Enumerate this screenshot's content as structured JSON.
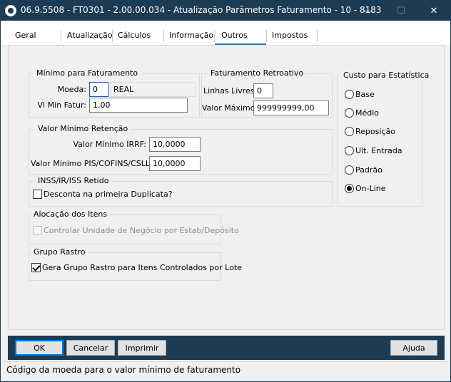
{
  "window": {
    "title": "06.9.5508 - FT0301 - 2.00.00.034 - Atualização Parâmetros Faturamento - 10 - 8183",
    "minimize_glyph": "—",
    "maximize_glyph": "☐",
    "close_glyph": "✕"
  },
  "tabs": [
    {
      "label": "Geral"
    },
    {
      "label": "Atualização"
    },
    {
      "label": "Cálculos"
    },
    {
      "label": "Informação"
    },
    {
      "label": "Outros",
      "active": true
    },
    {
      "label": "Impostos"
    }
  ],
  "minimo_faturamento": {
    "title": "Mínimo para Faturamento",
    "moeda_label": "Moeda:",
    "moeda_value": "0",
    "moeda_desc": "REAL",
    "vl_min_label": "Vl Min Fatur:",
    "vl_min_value": "1,00"
  },
  "faturamento_retroativo": {
    "title": "Faturamento Retroativo",
    "linhas_label": "Linhas Livres:",
    "linhas_value": "0",
    "valor_max_label": "Valor Máximo:",
    "valor_max_value": "999999999,00"
  },
  "custo_estatistica": {
    "title": "Custo para Estatística",
    "options": [
      {
        "label": "Base",
        "checked": false
      },
      {
        "label": "Médio",
        "checked": false
      },
      {
        "label": "Reposição",
        "checked": false
      },
      {
        "label": "Ult. Entrada",
        "checked": false
      },
      {
        "label": "Padrão",
        "checked": false
      },
      {
        "label": "On-Line",
        "checked": true
      }
    ]
  },
  "valor_minimo_retencao": {
    "title": "Valor Mínimo Retenção",
    "irrf_label": "Valor Mínimo IRRF:",
    "irrf_value": "10,0000",
    "pis_label": "Valor Mínimo PIS/COFINS/CSLL:",
    "pis_value": "10,0000"
  },
  "inss": {
    "title": "INSS/IR/ISS Retido",
    "checkbox_label": "Desconta na primeira Duplicata?",
    "checked": false
  },
  "alocacao": {
    "title": "Alocação dos Itens",
    "checkbox_label": "Controlar Unidade de Negócio por Estab/Depósito",
    "checked": false,
    "disabled": true
  },
  "grupo_rastro": {
    "title": "Grupo Rastro",
    "checkbox_label": "Gera Grupo Rastro para Itens Controlados por Lote",
    "checked": true
  },
  "buttons": {
    "ok": "OK",
    "cancelar": "Cancelar",
    "imprimir": "Imprimir",
    "ajuda": "Ajuda"
  },
  "status": {
    "text": "Código da moeda para o valor mínimo de faturamento"
  },
  "colors": {
    "titlebar": "#1c3b54",
    "accent": "#2b79c2"
  }
}
